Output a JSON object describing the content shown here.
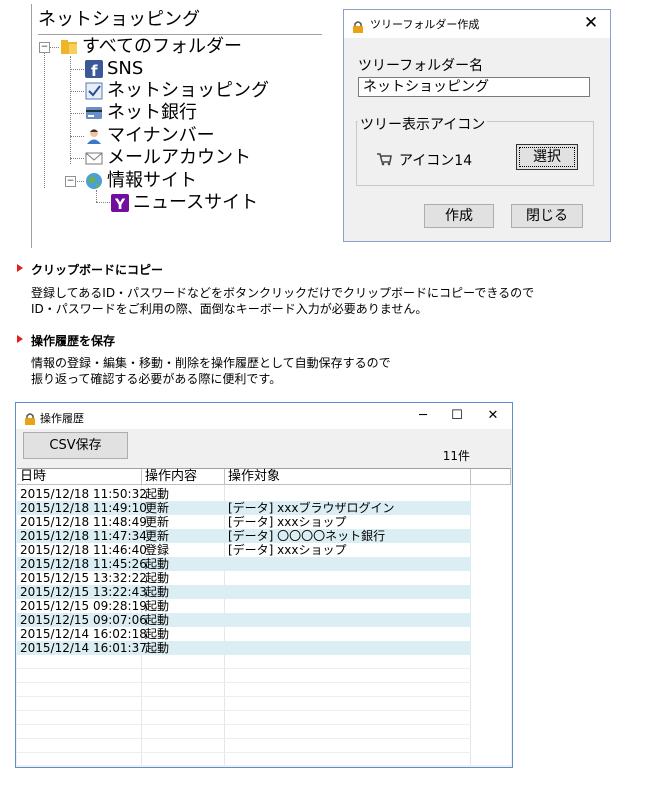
{
  "tree": {
    "title": "ネットショッピング",
    "root": "すべてのフォルダー",
    "items": [
      "SNS",
      "ネットショッピング",
      "ネット銀行",
      "マイナンバー",
      "メールアカウント",
      "情報サイト"
    ],
    "sub_items": [
      "ニュースサイト"
    ]
  },
  "dialog": {
    "title": "ツリーフォルダー作成",
    "close": "✕",
    "name_label": "ツリーフォルダー名",
    "name_value": "ネットショッピング",
    "group_label": "ツリー表示アイコン",
    "icon_label": "アイコン14",
    "select_button": "選択",
    "ok_button": "作成",
    "cancel_button": "閉じる"
  },
  "features": [
    {
      "heading": "クリップボードにコピー",
      "lines": [
        "登録してあるID・パスワードなどをボタンクリックだけでクリップボードにコピーできるので",
        "ID・パスワードをご利用の際、面倒なキーボード入力が必要ありません。"
      ]
    },
    {
      "heading": "操作履歴を保存",
      "lines": [
        "情報の登録・編集・移動・削除を操作履歴として自動保存するので",
        "振り返って確認する必要がある際に便利です。"
      ]
    }
  ],
  "history": {
    "title": "操作履歴",
    "minimize": "─",
    "maximize": "☐",
    "close": "✕",
    "csv_button": "CSV保存",
    "count": "11件",
    "columns": [
      "日時",
      "操作内容",
      "操作対象"
    ],
    "rows": [
      [
        "2015/12/18 11:50:32",
        "起動",
        ""
      ],
      [
        "2015/12/18 11:49:10",
        "更新",
        "[データ] xxxブラウザログイン"
      ],
      [
        "2015/12/18 11:48:49",
        "更新",
        "[データ] xxxショップ"
      ],
      [
        "2015/12/18 11:47:34",
        "更新",
        "[データ] 〇〇〇〇ネット銀行"
      ],
      [
        "2015/12/18 11:46:40",
        "登録",
        "[データ] xxxショップ"
      ],
      [
        "2015/12/18 11:45:26",
        "起動",
        ""
      ],
      [
        "2015/12/15 13:32:22",
        "起動",
        ""
      ],
      [
        "2015/12/15 13:22:43",
        "起動",
        ""
      ],
      [
        "2015/12/15 09:28:19",
        "起動",
        ""
      ],
      [
        "2015/12/15 09:07:06",
        "起動",
        ""
      ],
      [
        "2015/12/14 16:02:18",
        "起動",
        ""
      ],
      [
        "2015/12/14 16:01:37",
        "起動",
        ""
      ]
    ]
  },
  "colors": {
    "accent_red": "#e02020",
    "row_alt": "#dbeef4",
    "window_border": "#5a8fd0"
  }
}
